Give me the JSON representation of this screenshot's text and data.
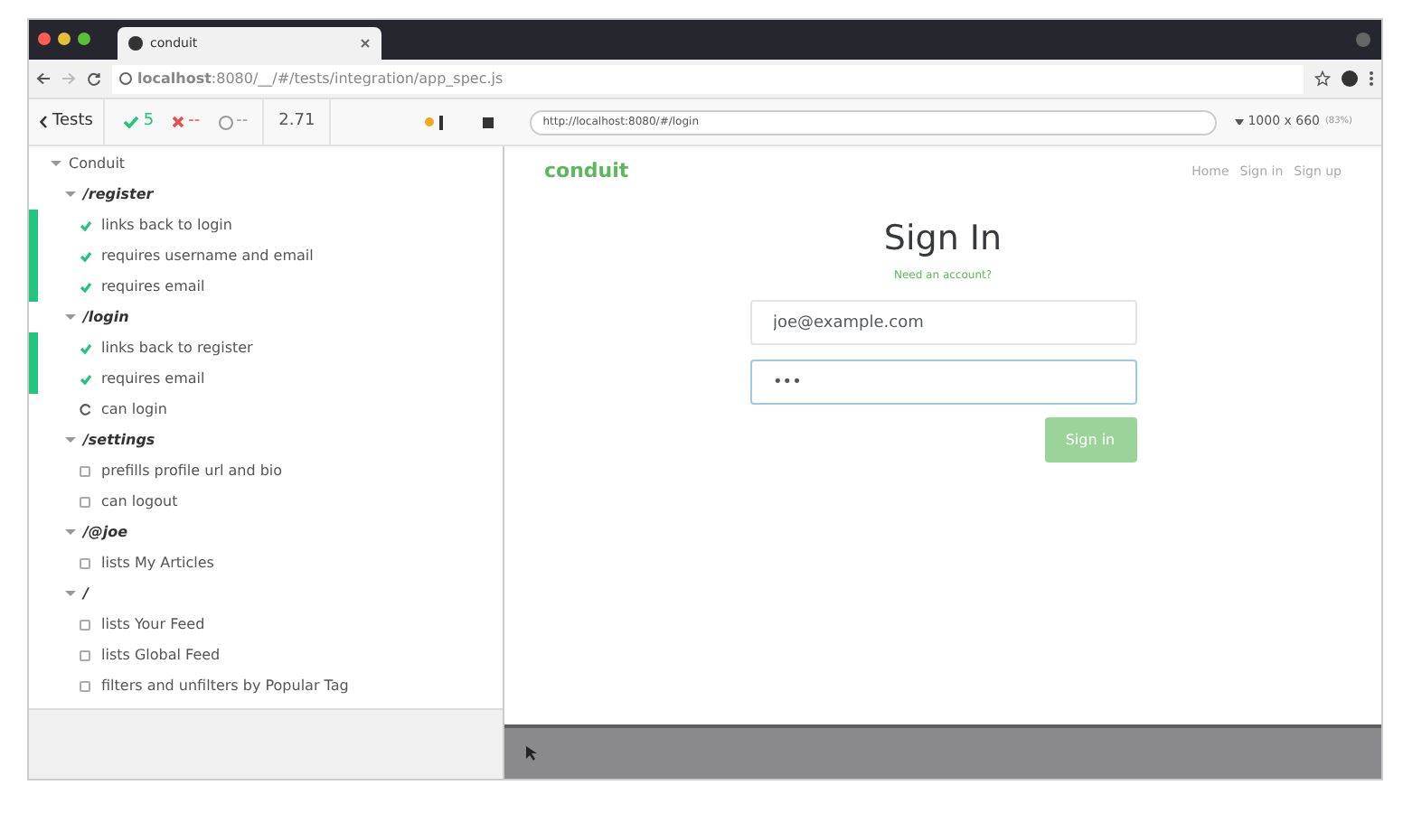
{
  "browser_tab": {
    "title": "conduit"
  },
  "address_bar": {
    "url": "**localhost**:8080/__/#/tests/integration/app_spec.js"
  },
  "toolbar": {
    "back": "Tests",
    "passed": "5",
    "failed": "--",
    "pending": "--",
    "duration": "2.71",
    "url": "http://localhost:8080/#/login",
    "viewport": "1000 x 660",
    "scale": "(83%)"
  },
  "tests": [
    {
      "kind": "suite",
      "title": "Conduit",
      "children": [
        {
          "kind": "suite",
          "title": "/register",
          "children": [
            {
              "kind": "passed",
              "title": "links back to login"
            },
            {
              "kind": "passed",
              "title": "requires username and email"
            },
            {
              "kind": "passed",
              "title": "requires email"
            }
          ]
        },
        {
          "kind": "suite",
          "title": "/login",
          "children": [
            {
              "kind": "passed",
              "title": "links back to register"
            },
            {
              "kind": "passed",
              "title": "requires email"
            },
            {
              "kind": "running",
              "title": "can login"
            }
          ]
        },
        {
          "kind": "suite",
          "title": "/settings",
          "children": [
            {
              "kind": "queued",
              "title": "prefills profile url and bio"
            },
            {
              "kind": "queued",
              "title": "can logout"
            }
          ]
        },
        {
          "kind": "suite",
          "title": "/@joe",
          "children": [
            {
              "kind": "queued",
              "title": "lists My Articles"
            }
          ]
        },
        {
          "kind": "suite",
          "title": "/",
          "children": [
            {
              "kind": "queued",
              "title": "lists Your Feed"
            },
            {
              "kind": "queued",
              "title": "lists Global Feed"
            },
            {
              "kind": "queued",
              "title": "filters and unfilters by Popular Tag"
            }
          ]
        }
      ]
    }
  ],
  "app": {
    "brand": "conduit",
    "nav": [
      "Home",
      "Sign in",
      "Sign up"
    ],
    "title": "Sign In",
    "link": "Need an account?",
    "fields": [
      {
        "value": "joe@example.com",
        "focused": false
      },
      {
        "value": "•••",
        "focused": true
      }
    ],
    "submit": {
      "label": "Sign in",
      "disabled": true
    }
  }
}
